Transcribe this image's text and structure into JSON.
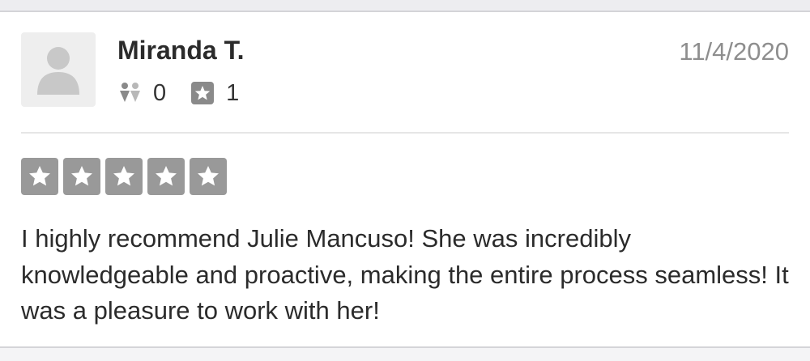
{
  "review": {
    "user_name": "Miranda T.",
    "date": "11/4/2020",
    "friends_count": "0",
    "reviews_count": "1",
    "rating": 5,
    "rating_max": 5,
    "text": "I highly recommend Julie Mancuso! She was incredibly knowledgeable and proactive, making the entire process seamless! It was a pleasure to work with her!"
  },
  "icons": {
    "avatar": "user-placeholder-icon",
    "friends": "friends-icon",
    "reviews": "review-star-icon",
    "star": "star-icon"
  },
  "colors": {
    "star_box": "#999999",
    "date": "#8e8e8e",
    "avatar_bg": "#eeeeee"
  }
}
